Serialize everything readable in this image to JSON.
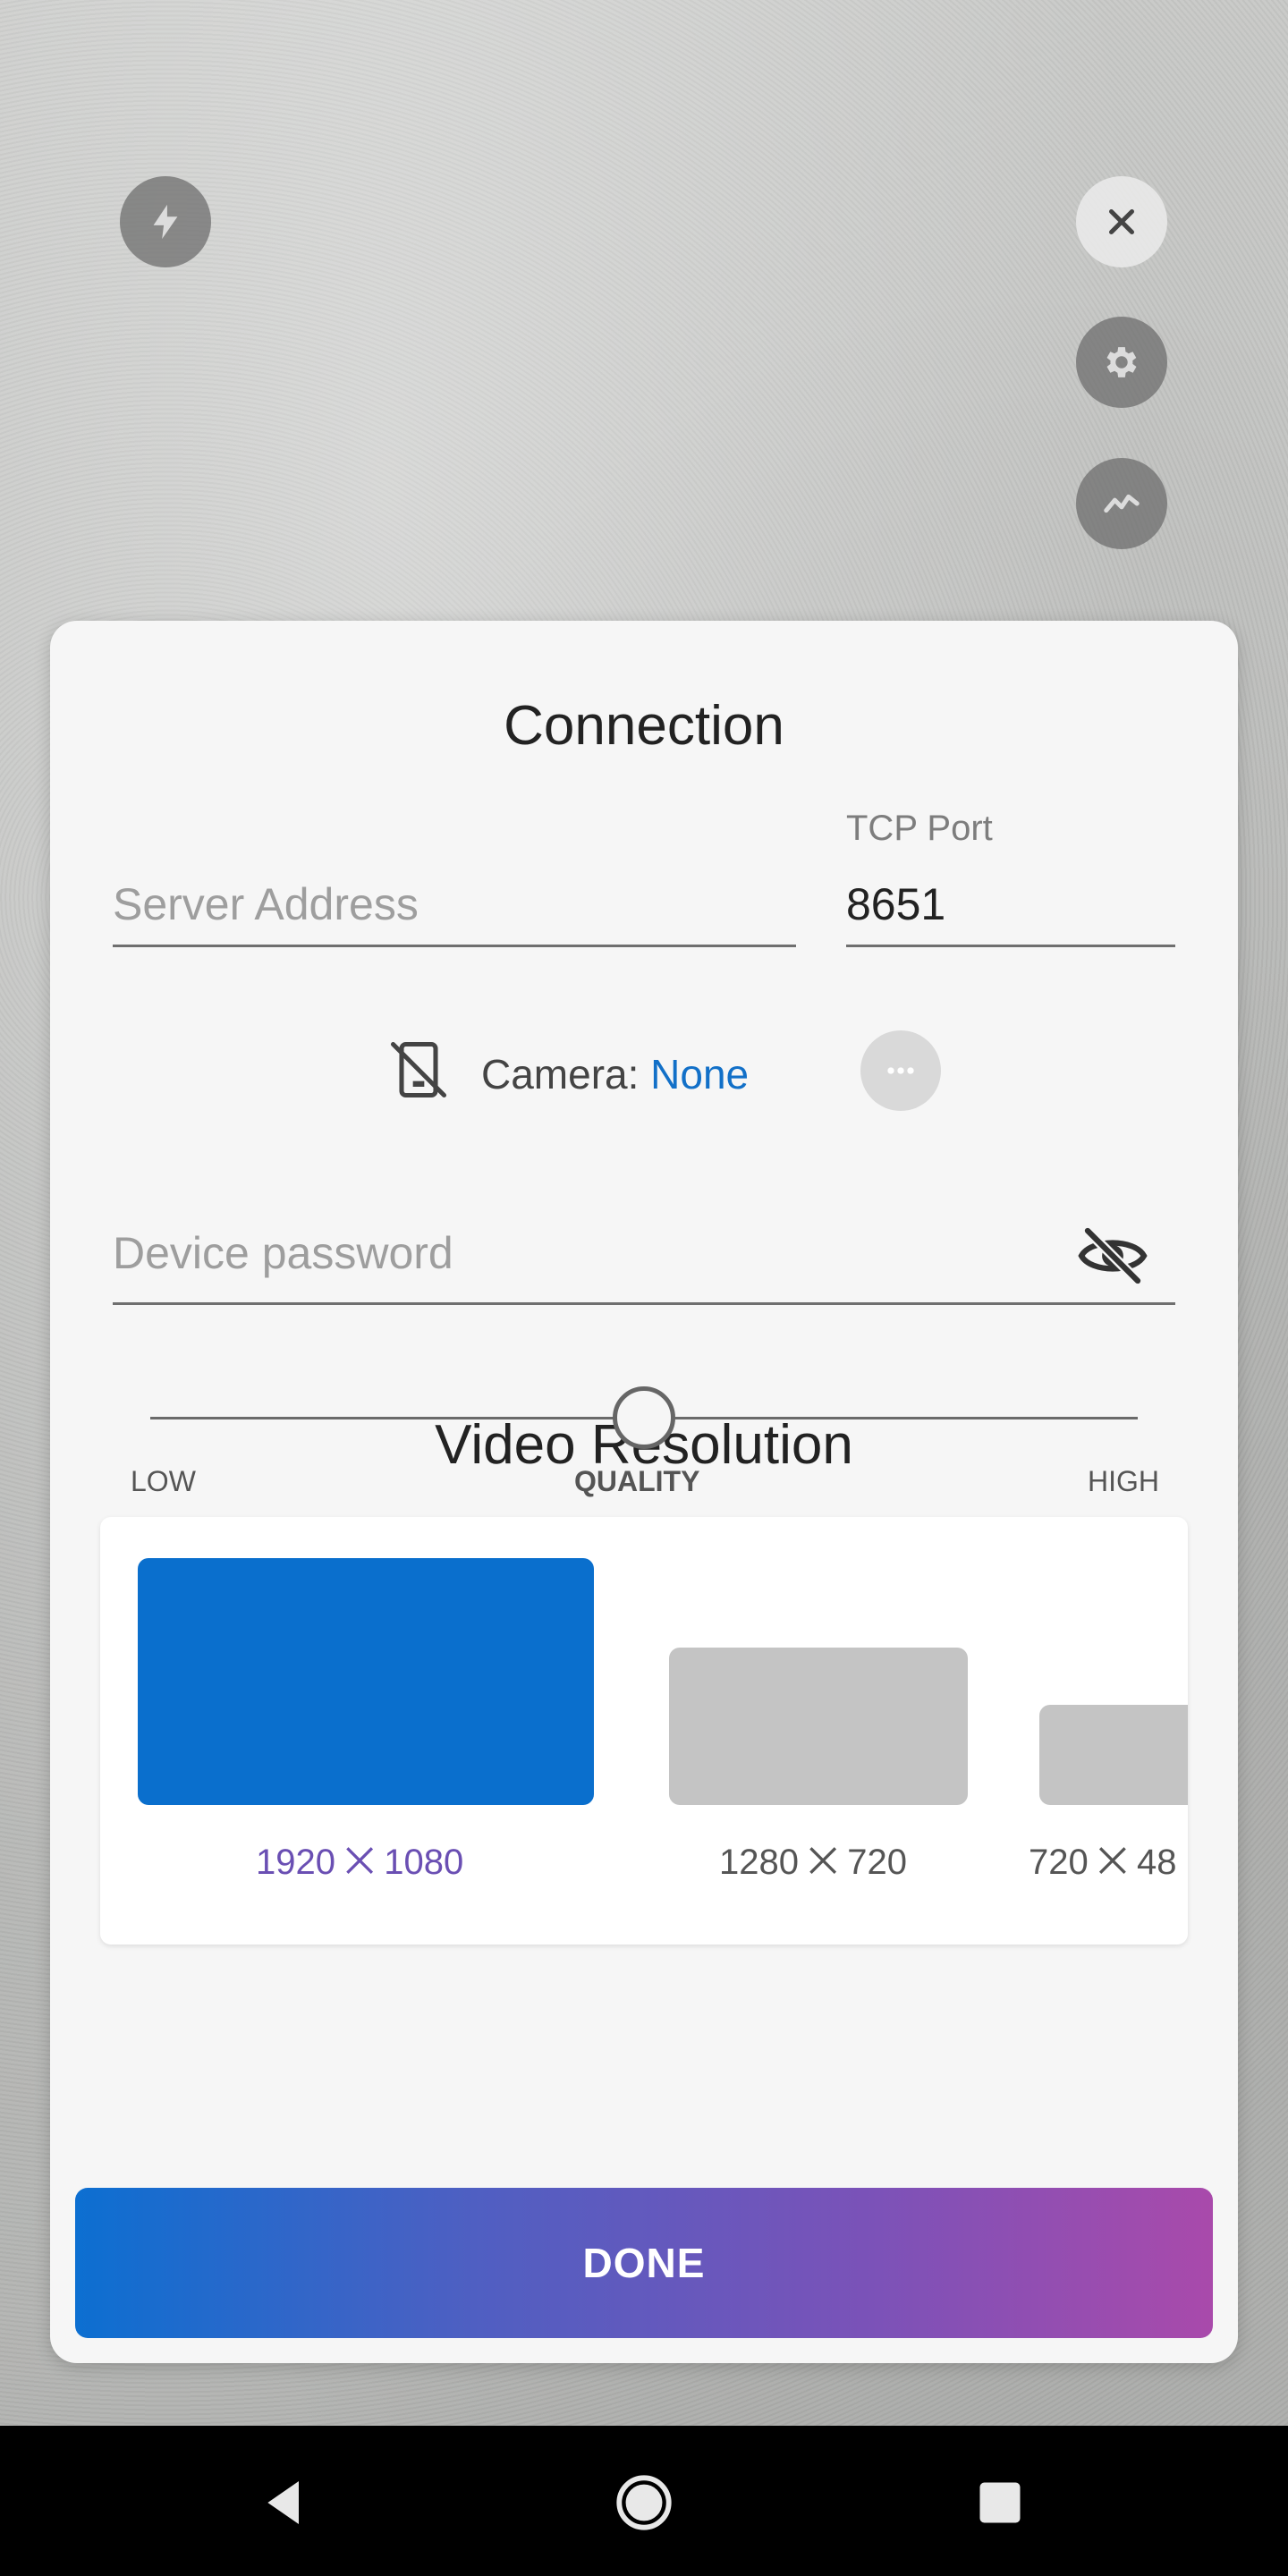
{
  "top_controls": {
    "flash_icon": "flash-icon",
    "close_icon": "close-icon",
    "settings_icon": "gear-icon",
    "stats_icon": "trend-icon"
  },
  "connection": {
    "title": "Connection",
    "server_address_placeholder": "Server Address",
    "server_address_value": "",
    "tcp_port_label": "TCP Port",
    "tcp_port_value": "8651",
    "camera_label": "Camera: ",
    "camera_value": "None",
    "device_password_placeholder": "Device password"
  },
  "video_resolution": {
    "title": "Video Resolution",
    "options": [
      {
        "label": "1920 ⨉ 1080",
        "selected": true
      },
      {
        "label": "1280 ⨉ 720",
        "selected": false
      },
      {
        "label": "720 ⨉ 48",
        "selected": false
      }
    ]
  },
  "quality": {
    "low_label": "LOW",
    "label": "QUALITY",
    "high_label": "HIGH",
    "value": 0.5
  },
  "done_label": "DONE",
  "colors": {
    "accent_blue": "#0a6fcd",
    "selected_label": "#6a4fb3",
    "button_gradient_start": "#0c6fd1",
    "button_gradient_end": "#a94aab"
  }
}
